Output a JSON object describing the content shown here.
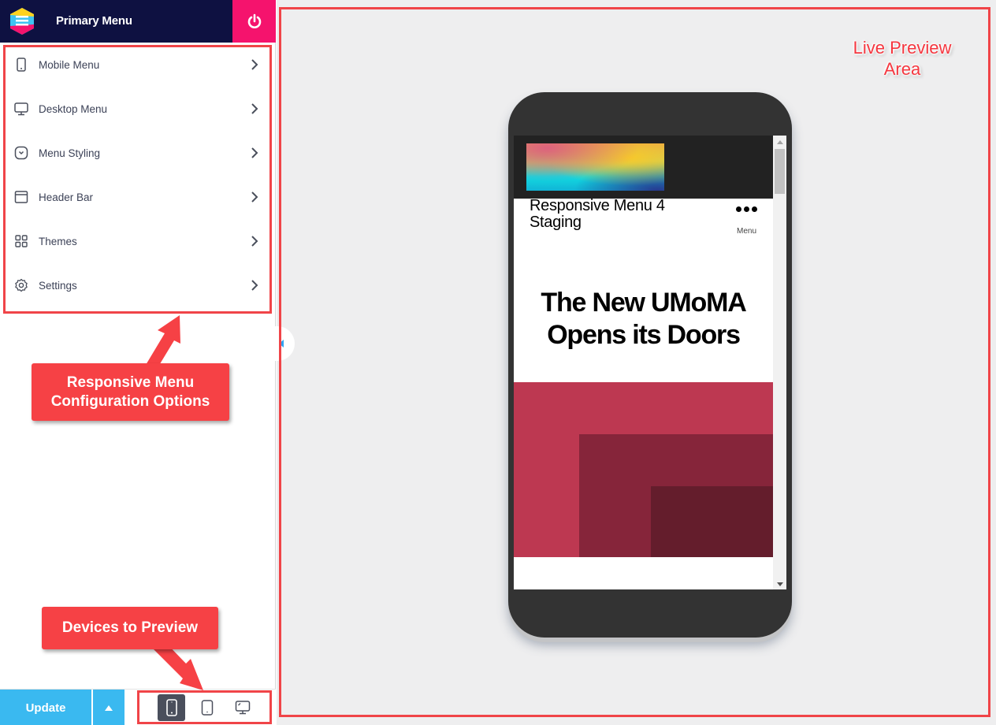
{
  "app": {
    "title": "Primary Menu",
    "logo_icon": "responsive-menu-logo-icon",
    "power_icon": "power-icon"
  },
  "sidebar": {
    "items": [
      {
        "label": "Mobile Menu",
        "icon": "mobile-phone-icon"
      },
      {
        "label": "Desktop Menu",
        "icon": "desktop-monitor-icon"
      },
      {
        "label": "Menu Styling",
        "icon": "dropdown-circle-icon"
      },
      {
        "label": "Header Bar",
        "icon": "window-icon"
      },
      {
        "label": "Themes",
        "icon": "grid-icon"
      },
      {
        "label": "Settings",
        "icon": "gear-icon"
      }
    ]
  },
  "footer": {
    "update_label": "Update",
    "devices": [
      {
        "name": "mobile",
        "icon": "mobile-phone-icon",
        "active": true
      },
      {
        "name": "tablet",
        "icon": "tablet-icon",
        "active": false
      },
      {
        "name": "desktop",
        "icon": "desktop-monitor-icon",
        "active": false
      }
    ]
  },
  "preview": {
    "site_title": "Responsive Menu 4 Staging",
    "menu_label": "Menu",
    "hero_title": "The New UMoMA Opens its Doors"
  },
  "annotations": {
    "config_callout": "Responsive Menu Configuration Options",
    "devices_callout": "Devices to Preview",
    "live_preview_label": "Live Preview Area"
  },
  "colors": {
    "topbar": "#0e1141",
    "power": "#f5136d",
    "update": "#3ab9f0",
    "annotation_red": "#f64145",
    "hero_red": "#bd3851"
  }
}
